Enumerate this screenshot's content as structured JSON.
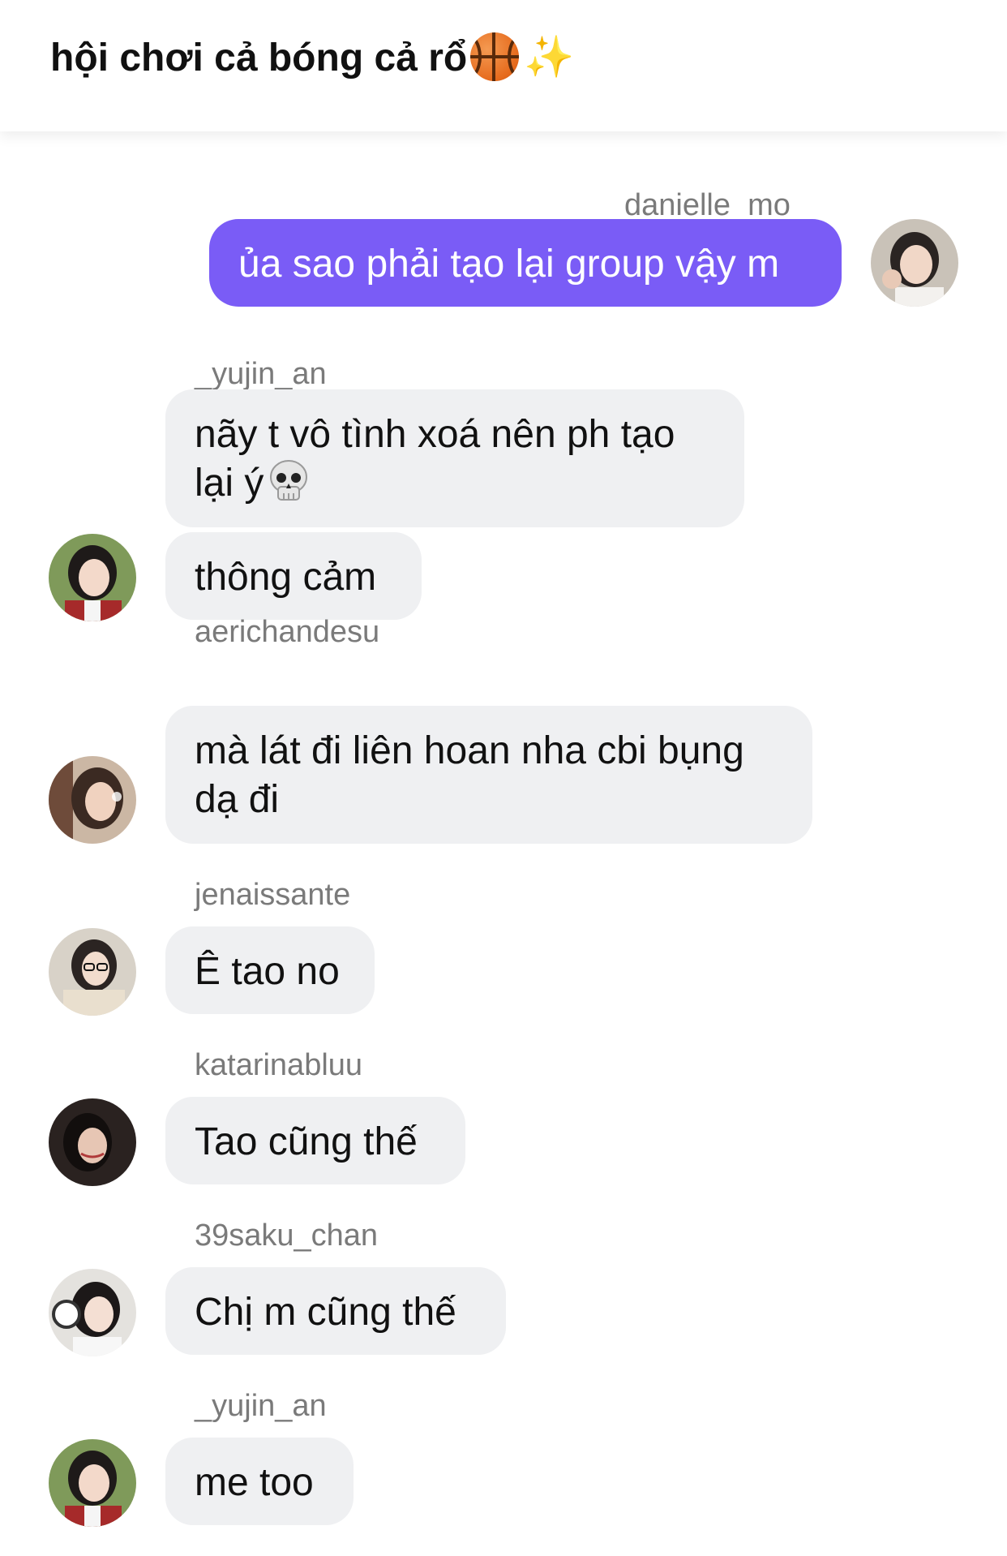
{
  "header": {
    "title": "hội chơi cả bóng cả rổ",
    "title_icons": [
      "basketball-icon",
      "sparkles-icon"
    ]
  },
  "messages": [
    {
      "sender": "danielle_mo",
      "text": "ủa sao phải tạo lại group vậy m",
      "outgoing": true
    },
    {
      "sender": "_yujin_an",
      "text": "nãy t vô tình xoá nên ph tạo lại ý",
      "emoji": "skull-icon",
      "outgoing": false
    },
    {
      "sender": "",
      "text": "thông cảm",
      "outgoing": false
    },
    {
      "sender": "aerichandesu",
      "text": "mà lát đi liên hoan nha cbi bụng dạ đi",
      "outgoing": false
    },
    {
      "sender": "jenaissante",
      "text": "Ê tao no",
      "outgoing": false
    },
    {
      "sender": "katarinabluu",
      "text": "Tao cũng thế",
      "outgoing": false
    },
    {
      "sender": "39saku_chan",
      "text": "Chị m cũng thế",
      "outgoing": false
    },
    {
      "sender": "_yujin_an",
      "text": "me too",
      "outgoing": false
    }
  ],
  "colors": {
    "outgoing_bubble": "#7a5cf6",
    "incoming_bubble": "#eff0f2",
    "sender_text": "#7a7a7a"
  }
}
